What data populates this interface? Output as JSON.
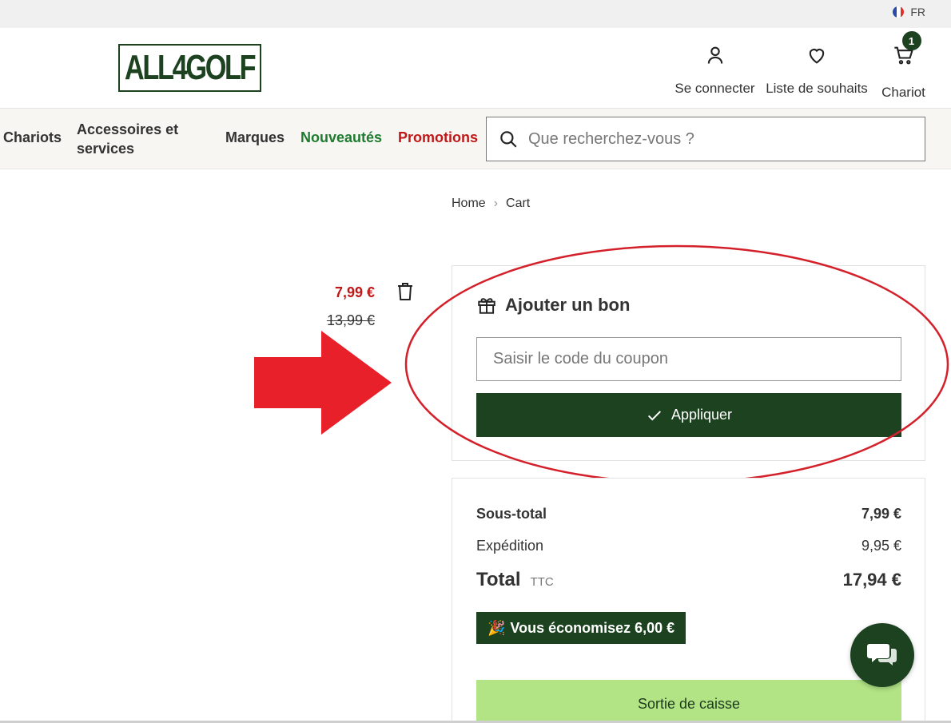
{
  "topbar": {
    "language": "FR"
  },
  "header": {
    "logo_text": "ALL4GOLF",
    "login_label": "Se connecter",
    "wishlist_label": "Liste de souhaits",
    "cart_label": "Chariot",
    "cart_count": "1"
  },
  "nav": {
    "items": [
      {
        "label": "Chariots"
      },
      {
        "label": "Accessoires et services"
      },
      {
        "label": "Marques"
      },
      {
        "label": "Nouveautés"
      },
      {
        "label": "Promotions"
      }
    ],
    "search_placeholder": "Que recherchez-vous ?"
  },
  "breadcrumb": {
    "home": "Home",
    "current": "Cart"
  },
  "cart_item": {
    "price_new": "7,99 €",
    "price_old": "13,99 €"
  },
  "coupon": {
    "title": "Ajouter un bon",
    "placeholder": "Saisir le code du coupon",
    "apply_label": "Appliquer"
  },
  "summary": {
    "subtotal_label": "Sous-total",
    "subtotal_value": "7,99 €",
    "shipping_label": "Expédition",
    "shipping_value": "9,95 €",
    "total_label": "Total",
    "total_tax": "TTC",
    "total_value": "17,94 €",
    "savings": "Vous économisez 6,00 €",
    "checkout_label": "Sortie de caisse"
  },
  "colors": {
    "brand_green": "#1d4220",
    "promo_red": "#c01818",
    "new_green": "#1e7b2f",
    "checkout_green": "#b2e486",
    "annotation_red": "#e8202a"
  },
  "icons": {
    "user": "user-icon",
    "wishlist": "heart-icon",
    "cart": "cart-icon",
    "search": "search-icon",
    "trash": "trash-icon",
    "gift": "gift-icon",
    "check": "check-icon",
    "party": "party-popper-icon",
    "chat": "chat-icon"
  }
}
